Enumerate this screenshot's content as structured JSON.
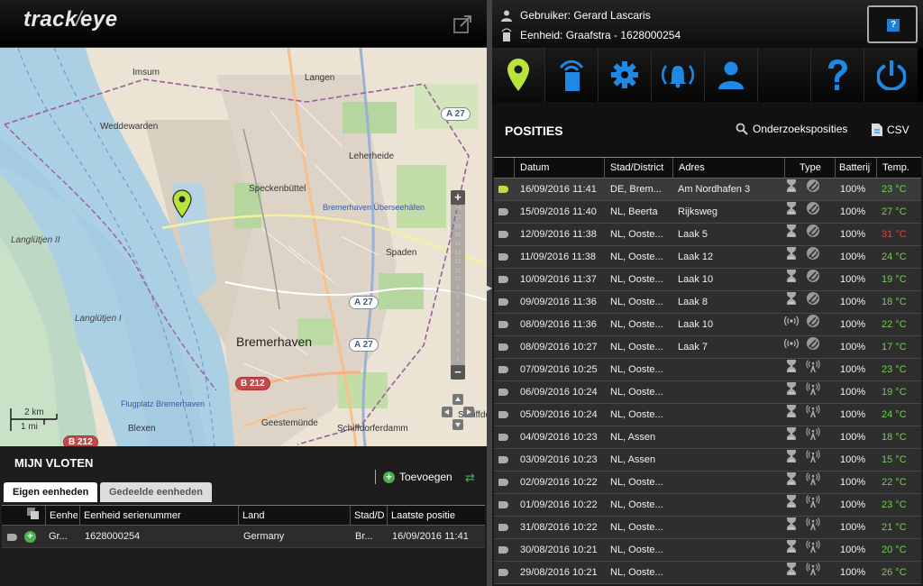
{
  "app": {
    "logo_text_a": "track",
    "logo_text_b": "eye"
  },
  "user": {
    "user_line": "Gebruiker: Gerard Lascaris",
    "unit_line": "Eenheid: Graafstra - 1628000254",
    "help_label": "?"
  },
  "map": {
    "labels": {
      "imsum": "Imsum",
      "langen": "Langen",
      "weddewarden": "Weddewarden",
      "leherheide": "Leherheide",
      "speckenbuettel": "Speckenbüttel",
      "bremerhaven_area": "Bremerhaven Überseehäfen",
      "langlutjen2": "Langlütjen II",
      "spaden": "Spaden",
      "langlutjen1": "Langlütjen I",
      "bremerhaven": "Bremerhaven",
      "flugplatz": "Flugplatz Bremerhaven",
      "geestemuende": "Geestemünde",
      "schiffdorferdamm": "Schiffdorferdamm",
      "blexen": "Blexen",
      "schiffdorf": "Schiffdorf"
    },
    "shields": {
      "a27_top": "A 27",
      "a27_mid": "A 27",
      "a27_low": "A 27",
      "b212_mid": "B 212",
      "b212_low": "B 212"
    },
    "scale": {
      "km": "2 km",
      "mi": "1 mi"
    },
    "zoom": {
      "plus": "+",
      "minus": "−",
      "ticks": [
        "18",
        "17",
        "16",
        "15",
        "14",
        "13",
        "12",
        "11",
        "10",
        "9",
        "8",
        "7",
        "6",
        "5",
        "4",
        "3",
        "2",
        "1"
      ]
    }
  },
  "fleets": {
    "title": "MIJN VLOTEN",
    "add_label": "Toevoegen",
    "tabs": {
      "own": "Eigen eenheden",
      "shared": "Gedeelde eenheden"
    },
    "columns": [
      "Eenhei",
      "Eenheid serienummer",
      "Land",
      "Stad/D",
      "Laatste positie"
    ],
    "rows": [
      {
        "name": "Gr...",
        "serial": "1628000254",
        "country": "Germany",
        "city": "Br...",
        "last": "16/09/2016 11:41"
      }
    ]
  },
  "positions": {
    "title": "POSITIES",
    "research_label": "Onderzoeksposities",
    "csv_label": "CSV",
    "columns": {
      "date": "Datum",
      "city": "Stad/District",
      "address": "Adres",
      "type": "Type",
      "battery": "Batterij",
      "temp": "Temp."
    },
    "rows": [
      {
        "date": "16/09/2016 11:41",
        "city": "DE, Brem...",
        "address": "Am Nordhafen 3",
        "mode": "gps",
        "battery": "100%",
        "temp": "23 °C",
        "hot": false,
        "selected": true
      },
      {
        "date": "15/09/2016 11:40",
        "city": "NL, Beerta",
        "address": "Rijksweg",
        "mode": "gps",
        "battery": "100%",
        "temp": "27 °C",
        "hot": false,
        "selected": false
      },
      {
        "date": "12/09/2016 11:38",
        "city": "NL, Ooste...",
        "address": "Laak 5",
        "mode": "gps",
        "battery": "100%",
        "temp": "31 °C",
        "hot": true,
        "selected": false
      },
      {
        "date": "11/09/2016 11:38",
        "city": "NL, Ooste...",
        "address": "Laak 12",
        "mode": "gps",
        "battery": "100%",
        "temp": "24 °C",
        "hot": false,
        "selected": false
      },
      {
        "date": "10/09/2016 11:37",
        "city": "NL, Ooste...",
        "address": "Laak 10",
        "mode": "gps",
        "battery": "100%",
        "temp": "19 °C",
        "hot": false,
        "selected": false
      },
      {
        "date": "09/09/2016 11:36",
        "city": "NL, Ooste...",
        "address": "Laak 8",
        "mode": "gps",
        "battery": "100%",
        "temp": "18 °C",
        "hot": false,
        "selected": false
      },
      {
        "date": "08/09/2016 11:36",
        "city": "NL, Ooste...",
        "address": "Laak 10",
        "mode": "wifi-gps",
        "battery": "100%",
        "temp": "22 °C",
        "hot": false,
        "selected": false
      },
      {
        "date": "08/09/2016 10:27",
        "city": "NL, Ooste...",
        "address": "Laak 7",
        "mode": "wifi-gps",
        "battery": "100%",
        "temp": "17 °C",
        "hot": false,
        "selected": false
      },
      {
        "date": "07/09/2016 10:25",
        "city": "NL, Ooste...",
        "address": "",
        "mode": "gsm",
        "battery": "100%",
        "temp": "23 °C",
        "hot": false,
        "selected": false
      },
      {
        "date": "06/09/2016 10:24",
        "city": "NL, Ooste...",
        "address": "",
        "mode": "gsm",
        "battery": "100%",
        "temp": "19 °C",
        "hot": false,
        "selected": false
      },
      {
        "date": "05/09/2016 10:24",
        "city": "NL, Ooste...",
        "address": "",
        "mode": "gsm",
        "battery": "100%",
        "temp": "24 °C",
        "hot": false,
        "selected": false
      },
      {
        "date": "04/09/2016 10:23",
        "city": "NL, Assen",
        "address": "",
        "mode": "gsm",
        "battery": "100%",
        "temp": "18 °C",
        "hot": false,
        "selected": false
      },
      {
        "date": "03/09/2016 10:23",
        "city": "NL, Assen",
        "address": "",
        "mode": "gsm",
        "battery": "100%",
        "temp": "15 °C",
        "hot": false,
        "selected": false
      },
      {
        "date": "02/09/2016 10:22",
        "city": "NL, Ooste...",
        "address": "",
        "mode": "gsm",
        "battery": "100%",
        "temp": "22 °C",
        "hot": false,
        "selected": false
      },
      {
        "date": "01/09/2016 10:22",
        "city": "NL, Ooste...",
        "address": "",
        "mode": "gsm",
        "battery": "100%",
        "temp": "23 °C",
        "hot": false,
        "selected": false
      },
      {
        "date": "31/08/2016 10:22",
        "city": "NL, Ooste...",
        "address": "",
        "mode": "gsm",
        "battery": "100%",
        "temp": "21 °C",
        "hot": false,
        "selected": false
      },
      {
        "date": "30/08/2016 10:21",
        "city": "NL, Ooste...",
        "address": "",
        "mode": "gsm",
        "battery": "100%",
        "temp": "20 °C",
        "hot": false,
        "selected": false
      },
      {
        "date": "29/08/2016 10:21",
        "city": "NL, Ooste...",
        "address": "",
        "mode": "gsm",
        "battery": "100%",
        "temp": "26 °C",
        "hot": false,
        "selected": false
      }
    ]
  },
  "colors": {
    "accent_blue": "#1e88e5",
    "active_green": "#b8e33a",
    "temp_ok": "#6fd14a",
    "temp_hot": "#e0463b"
  }
}
